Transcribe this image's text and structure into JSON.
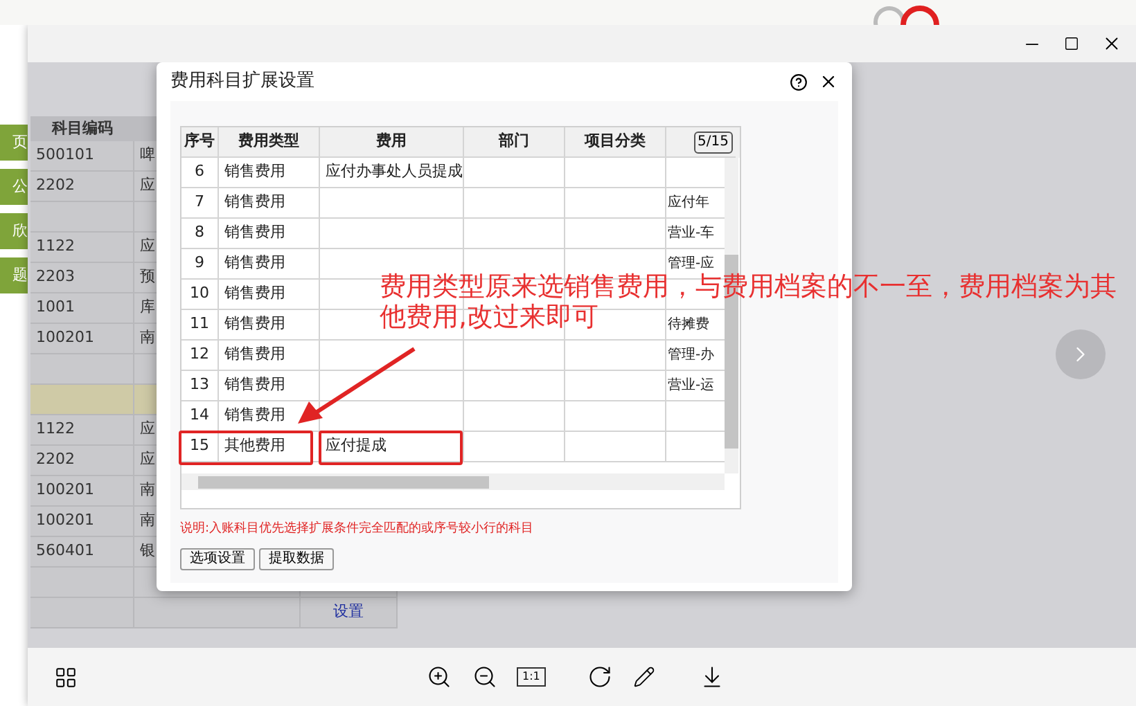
{
  "background_app": {
    "side_buttons": [
      "页",
      "公",
      "欣",
      "题"
    ],
    "table": {
      "columns": [
        "科目编码"
      ],
      "rows": [
        {
          "cells": [
            "500101",
            "啤"
          ],
          "highlighted": false
        },
        {
          "cells": [
            "2202",
            "应"
          ],
          "highlighted": false
        },
        {
          "highlighted": false
        },
        {
          "cells": [
            "1122",
            "应"
          ],
          "highlighted": false
        },
        {
          "cells": [
            "2203",
            "预"
          ],
          "highlighted": false
        },
        {
          "cells": [
            "1001",
            "库"
          ],
          "highlighted": false
        },
        {
          "cells": [
            "100201",
            "南"
          ],
          "highlighted": false
        },
        {
          "highlighted": false
        },
        {
          "highlighted": true
        },
        {
          "cells": [
            "1122",
            "应"
          ],
          "highlighted": false
        },
        {
          "cells": [
            "2202",
            "应"
          ],
          "highlighted": false
        },
        {
          "cells": [
            "100201",
            "南"
          ],
          "highlighted": false
        },
        {
          "cells": [
            "100201",
            "南"
          ],
          "highlighted": false
        },
        {
          "cells": [
            "560401",
            "银"
          ],
          "highlighted": false
        },
        {
          "highlighted": false
        },
        {
          "highlighted": false,
          "link": "设置"
        }
      ]
    }
  },
  "dialog": {
    "title": "费用科目扩展设置",
    "columns": [
      "序号",
      "费用类型",
      "费用",
      "部门",
      "项目分类"
    ],
    "page_badge": "5/15",
    "rows": [
      {
        "no": "6",
        "type": "销售费用",
        "expense": "应付办事处人员提成",
        "marked": false
      },
      {
        "no": "7",
        "type": "销售费用",
        "column_6": "应付年",
        "marked": false
      },
      {
        "no": "8",
        "type": "销售费用",
        "column_6": "营业-车",
        "marked": false
      },
      {
        "no": "9",
        "type": "销售费用",
        "column_6": "管理-应",
        "marked": false
      },
      {
        "no": "10",
        "type": "销售费用",
        "marked": false
      },
      {
        "no": "11",
        "type": "销售费用",
        "column_6": "待摊费",
        "marked": false
      },
      {
        "no": "12",
        "type": "销售费用",
        "column_6": "管理-办",
        "marked": false
      },
      {
        "no": "13",
        "type": "销售费用",
        "column_6": "营业-运",
        "marked": false
      },
      {
        "no": "14",
        "type": "销售费用",
        "marked": false
      },
      {
        "no": "15",
        "type": "其他费用",
        "expense": "应付提成",
        "marked": true
      }
    ],
    "note": "说明:入账科目优先选择扩展条件完全匹配的或序号较小行的科目",
    "buttons": [
      "选项设置",
      "提取数据"
    ]
  },
  "annotation": {
    "lines": [
      "费用类型原来选销售费用，与费用档案的不一至，费用档案为其",
      "他费用,改过来即可"
    ]
  },
  "toolbar": {
    "actual_size_label": "1:1"
  }
}
